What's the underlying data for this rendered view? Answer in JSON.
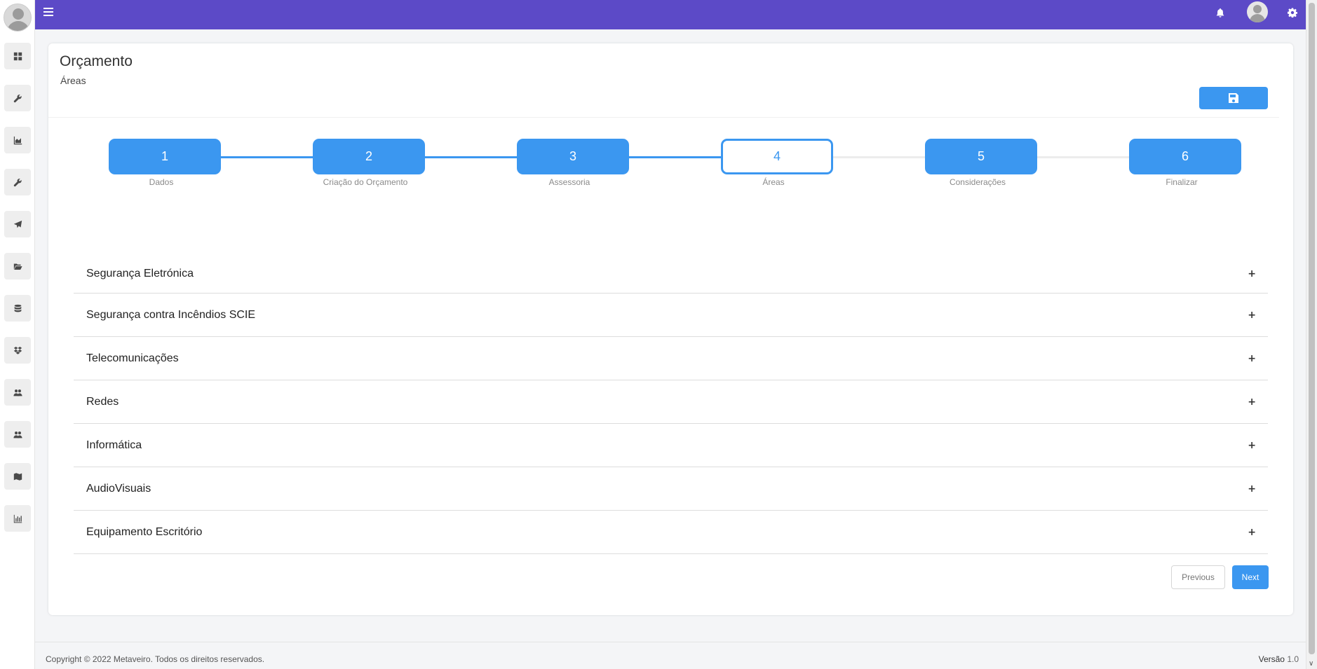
{
  "page": {
    "title": "Orçamento",
    "subtitle": "Áreas"
  },
  "sidebar": {
    "items": [
      {
        "icon": "dashboard-icon"
      },
      {
        "icon": "wrench-icon"
      },
      {
        "icon": "area-chart-icon"
      },
      {
        "icon": "wrench-icon"
      },
      {
        "icon": "paper-plane-icon"
      },
      {
        "icon": "folder-open-icon"
      },
      {
        "icon": "database-icon"
      },
      {
        "icon": "dropbox-icon"
      },
      {
        "icon": "users-icon"
      },
      {
        "icon": "users-icon"
      },
      {
        "icon": "map-icon"
      },
      {
        "icon": "bar-chart-icon"
      }
    ]
  },
  "stepper": {
    "current": 4,
    "steps": [
      {
        "number": "1",
        "label": "Dados"
      },
      {
        "number": "2",
        "label": "Criação do Orçamento"
      },
      {
        "number": "3",
        "label": "Assessoria"
      },
      {
        "number": "4",
        "label": "Áreas"
      },
      {
        "number": "5",
        "label": "Considerações"
      },
      {
        "number": "6",
        "label": "Finalizar"
      }
    ]
  },
  "areas": [
    {
      "label": "Segurança Eletrónica",
      "toggle": "+"
    },
    {
      "label": "Segurança contra Incêndios SCIE",
      "toggle": "+"
    },
    {
      "label": "Telecomunicações",
      "toggle": "+"
    },
    {
      "label": "Redes",
      "toggle": "+"
    },
    {
      "label": "Informática",
      "toggle": "+"
    },
    {
      "label": "AudioVisuais",
      "toggle": "+"
    },
    {
      "label": "Equipamento Escritório",
      "toggle": "+"
    }
  ],
  "nav": {
    "previous_label": "Previous",
    "next_label": "Next"
  },
  "footer": {
    "copyright": "Copyright © 2022 Metaveiro. Todos os direitos reservados.",
    "version_label": "Versão",
    "version_value": "1.0"
  },
  "colors": {
    "topbar": "#5c4ac7",
    "primary": "#3b97f0"
  }
}
